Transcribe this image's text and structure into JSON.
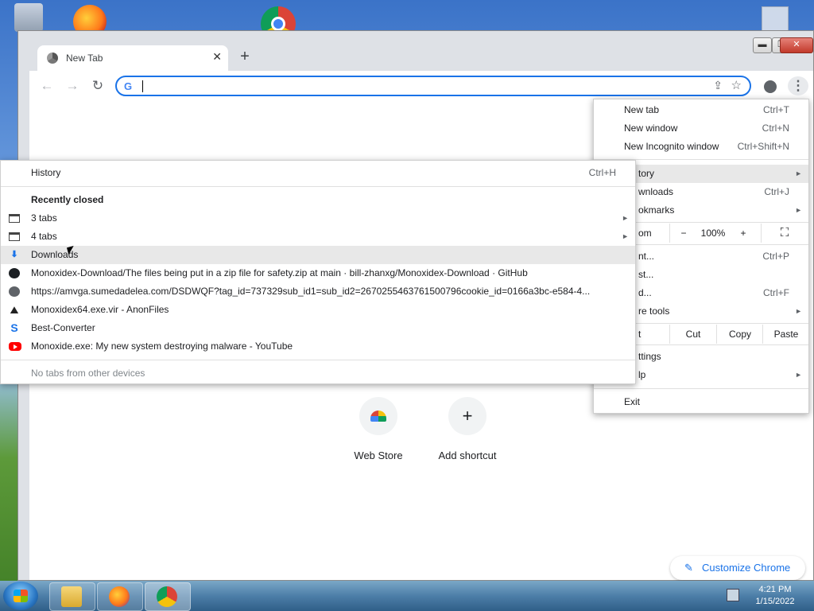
{
  "browser": {
    "tab_title": "New Tab",
    "tab_close": "✕",
    "new_tab": "+",
    "window_controls": {
      "minimize": "▬",
      "maximize": "❐",
      "close": "✕"
    }
  },
  "toolbar": {
    "back": "←",
    "forward": "→",
    "reload": "↻",
    "omnibox_value": "",
    "google_g": "G",
    "share": "⇪",
    "star": "☆",
    "menu": "⋮"
  },
  "page": {
    "shortcuts": [
      {
        "label": "Web Store",
        "icon": "webstore-icon"
      },
      {
        "label": "Add shortcut",
        "icon": "plus-icon",
        "glyph": "+"
      }
    ],
    "customize_label": "Customize Chrome",
    "pencil": "✎"
  },
  "chrome_menu": {
    "new_tab": {
      "label": "New tab",
      "shortcut": "Ctrl+T"
    },
    "new_window": {
      "label": "New window",
      "shortcut": "Ctrl+N"
    },
    "new_incognito": {
      "label": "New Incognito window",
      "shortcut": "Ctrl+Shift+N"
    },
    "history": {
      "label": "tory",
      "arrow": "►"
    },
    "downloads": {
      "label": "wnloads",
      "shortcut": "Ctrl+J"
    },
    "bookmarks": {
      "label": "okmarks",
      "arrow": "►"
    },
    "zoom": {
      "label": "om",
      "minus": "−",
      "value": "100%",
      "plus": "+",
      "fullscreen": "⛶"
    },
    "print": {
      "label": "nt...",
      "shortcut": "Ctrl+P"
    },
    "cast": {
      "label": "st..."
    },
    "find": {
      "label": "d...",
      "shortcut": "Ctrl+F"
    },
    "more_tools": {
      "label": "re tools",
      "arrow": "►"
    },
    "edit": {
      "label": "t",
      "cut": "Cut",
      "copy": "Copy",
      "paste": "Paste"
    },
    "settings": {
      "label": "ttings"
    },
    "help": {
      "label": "lp",
      "arrow": "►"
    },
    "exit": {
      "label": "Exit"
    }
  },
  "history_menu": {
    "history": {
      "label": "History",
      "shortcut": "Ctrl+H"
    },
    "recently_closed": "Recently closed",
    "items": [
      {
        "label": "3 tabs",
        "arrow": "►"
      },
      {
        "label": "4 tabs",
        "arrow": "►"
      },
      {
        "label": "Downloads",
        "icon": "⬇"
      },
      {
        "label": "Monoxidex-Download/The files being put in a zip file for safety.zip at main · bill-zhanxg/Monoxidex-Download · GitHub"
      },
      {
        "label": "https://amvga.sumedadelea.com/DSDWQF?tag_id=737329sub_id1=sub_id2=2670255463761500796cookie_id=0166a3bc-e584-4..."
      },
      {
        "label": "Monoxidex64.exe.vir - AnonFiles",
        "icon": "⛰"
      },
      {
        "label": "Best-Converter",
        "icon": "S"
      },
      {
        "label": "Monoxide.exe: My new system destroying malware - YouTube"
      }
    ],
    "no_tabs": "No tabs from other devices"
  },
  "taskbar": {
    "time": "4:21 PM",
    "date": "1/15/2022"
  },
  "colors": {
    "accent": "#1a73e8",
    "menu_highlight": "#e8e8e8",
    "youtube_red": "#ff0000"
  }
}
